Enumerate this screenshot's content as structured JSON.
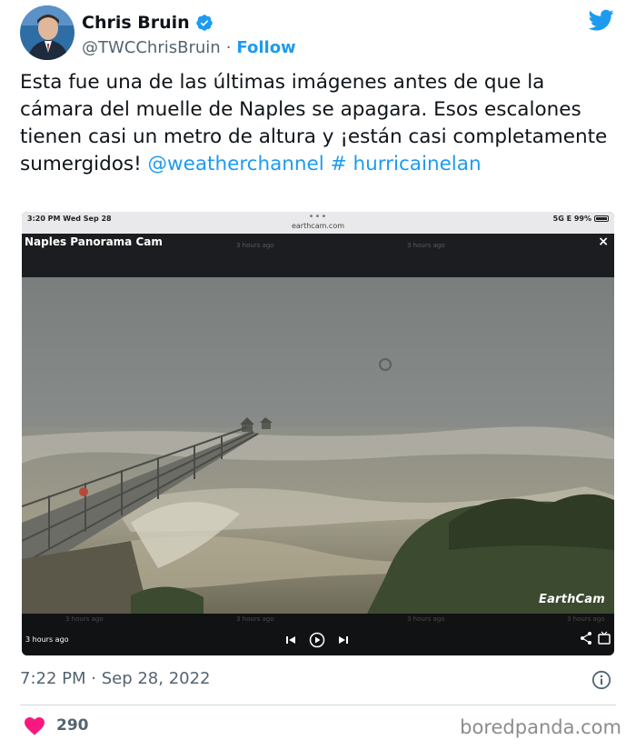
{
  "author": {
    "name": "Chris Bruin",
    "handle": "@TWCChrisBruin",
    "separator": "·",
    "follow_label": "Follow"
  },
  "tweet": {
    "text": "Esta fue una de las últimas imágenes antes de que la cámara del muelle de Naples se apagara. Esos escalones tienen casi un metro de altura y ¡están casi completamente sumergidos! ",
    "mention": "@weatherchannel",
    "hashtag_text": " # hurricainelan"
  },
  "media": {
    "status_time": "3:20 PM   Wed Sep 28",
    "url": "earthcam.com",
    "dots": "•••",
    "battery": "5G E 99%",
    "cam_title": "Naples Panorama Cam",
    "close": "×",
    "top_thumbs": [
      "3 hours ago",
      "3 hours ago"
    ],
    "bottom_thumbs": [
      "3 hours ago",
      "3 hours ago",
      "3 hours ago",
      "3 hours ago"
    ],
    "time_ago": "3 hours ago",
    "watermark": "EarthCam"
  },
  "meta": {
    "timestamp": "7:22 PM · Sep 28, 2022"
  },
  "engagement": {
    "likes": "290"
  },
  "site_watermark": "boredpanda.com",
  "colors": {
    "accent": "#1d9bf0",
    "like": "#f91880",
    "secondary_text": "#536471"
  }
}
